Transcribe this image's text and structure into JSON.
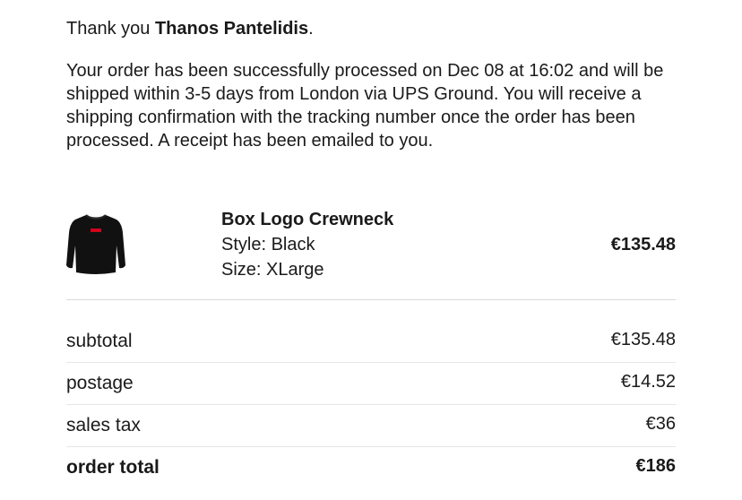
{
  "greeting": {
    "prefix": "Thank you ",
    "name": "Thanos Pantelidis",
    "suffix": "."
  },
  "message": "Your order has been successfully processed on Dec 08 at 16:02 and will be shipped within 3-5 days from London via UPS Ground. You will receive a shipping confirmation with the tracking number once the order has been processed. A receipt has been emailed to you.",
  "item": {
    "image_icon": "black-crewneck-sweatshirt-icon",
    "title": "Box Logo Crewneck",
    "style": "Style: Black",
    "size": "Size: XLarge",
    "price": "€135.48"
  },
  "totals": [
    {
      "label": "subtotal",
      "value": "€135.48"
    },
    {
      "label": "postage",
      "value": "€14.52"
    },
    {
      "label": "sales tax",
      "value": "€36"
    },
    {
      "label": "order total",
      "value": "€186"
    }
  ],
  "colors": {
    "text": "#1a1a1a",
    "divider": "#d9d9d9",
    "garment": "#111111",
    "logo": "#d0021b"
  }
}
